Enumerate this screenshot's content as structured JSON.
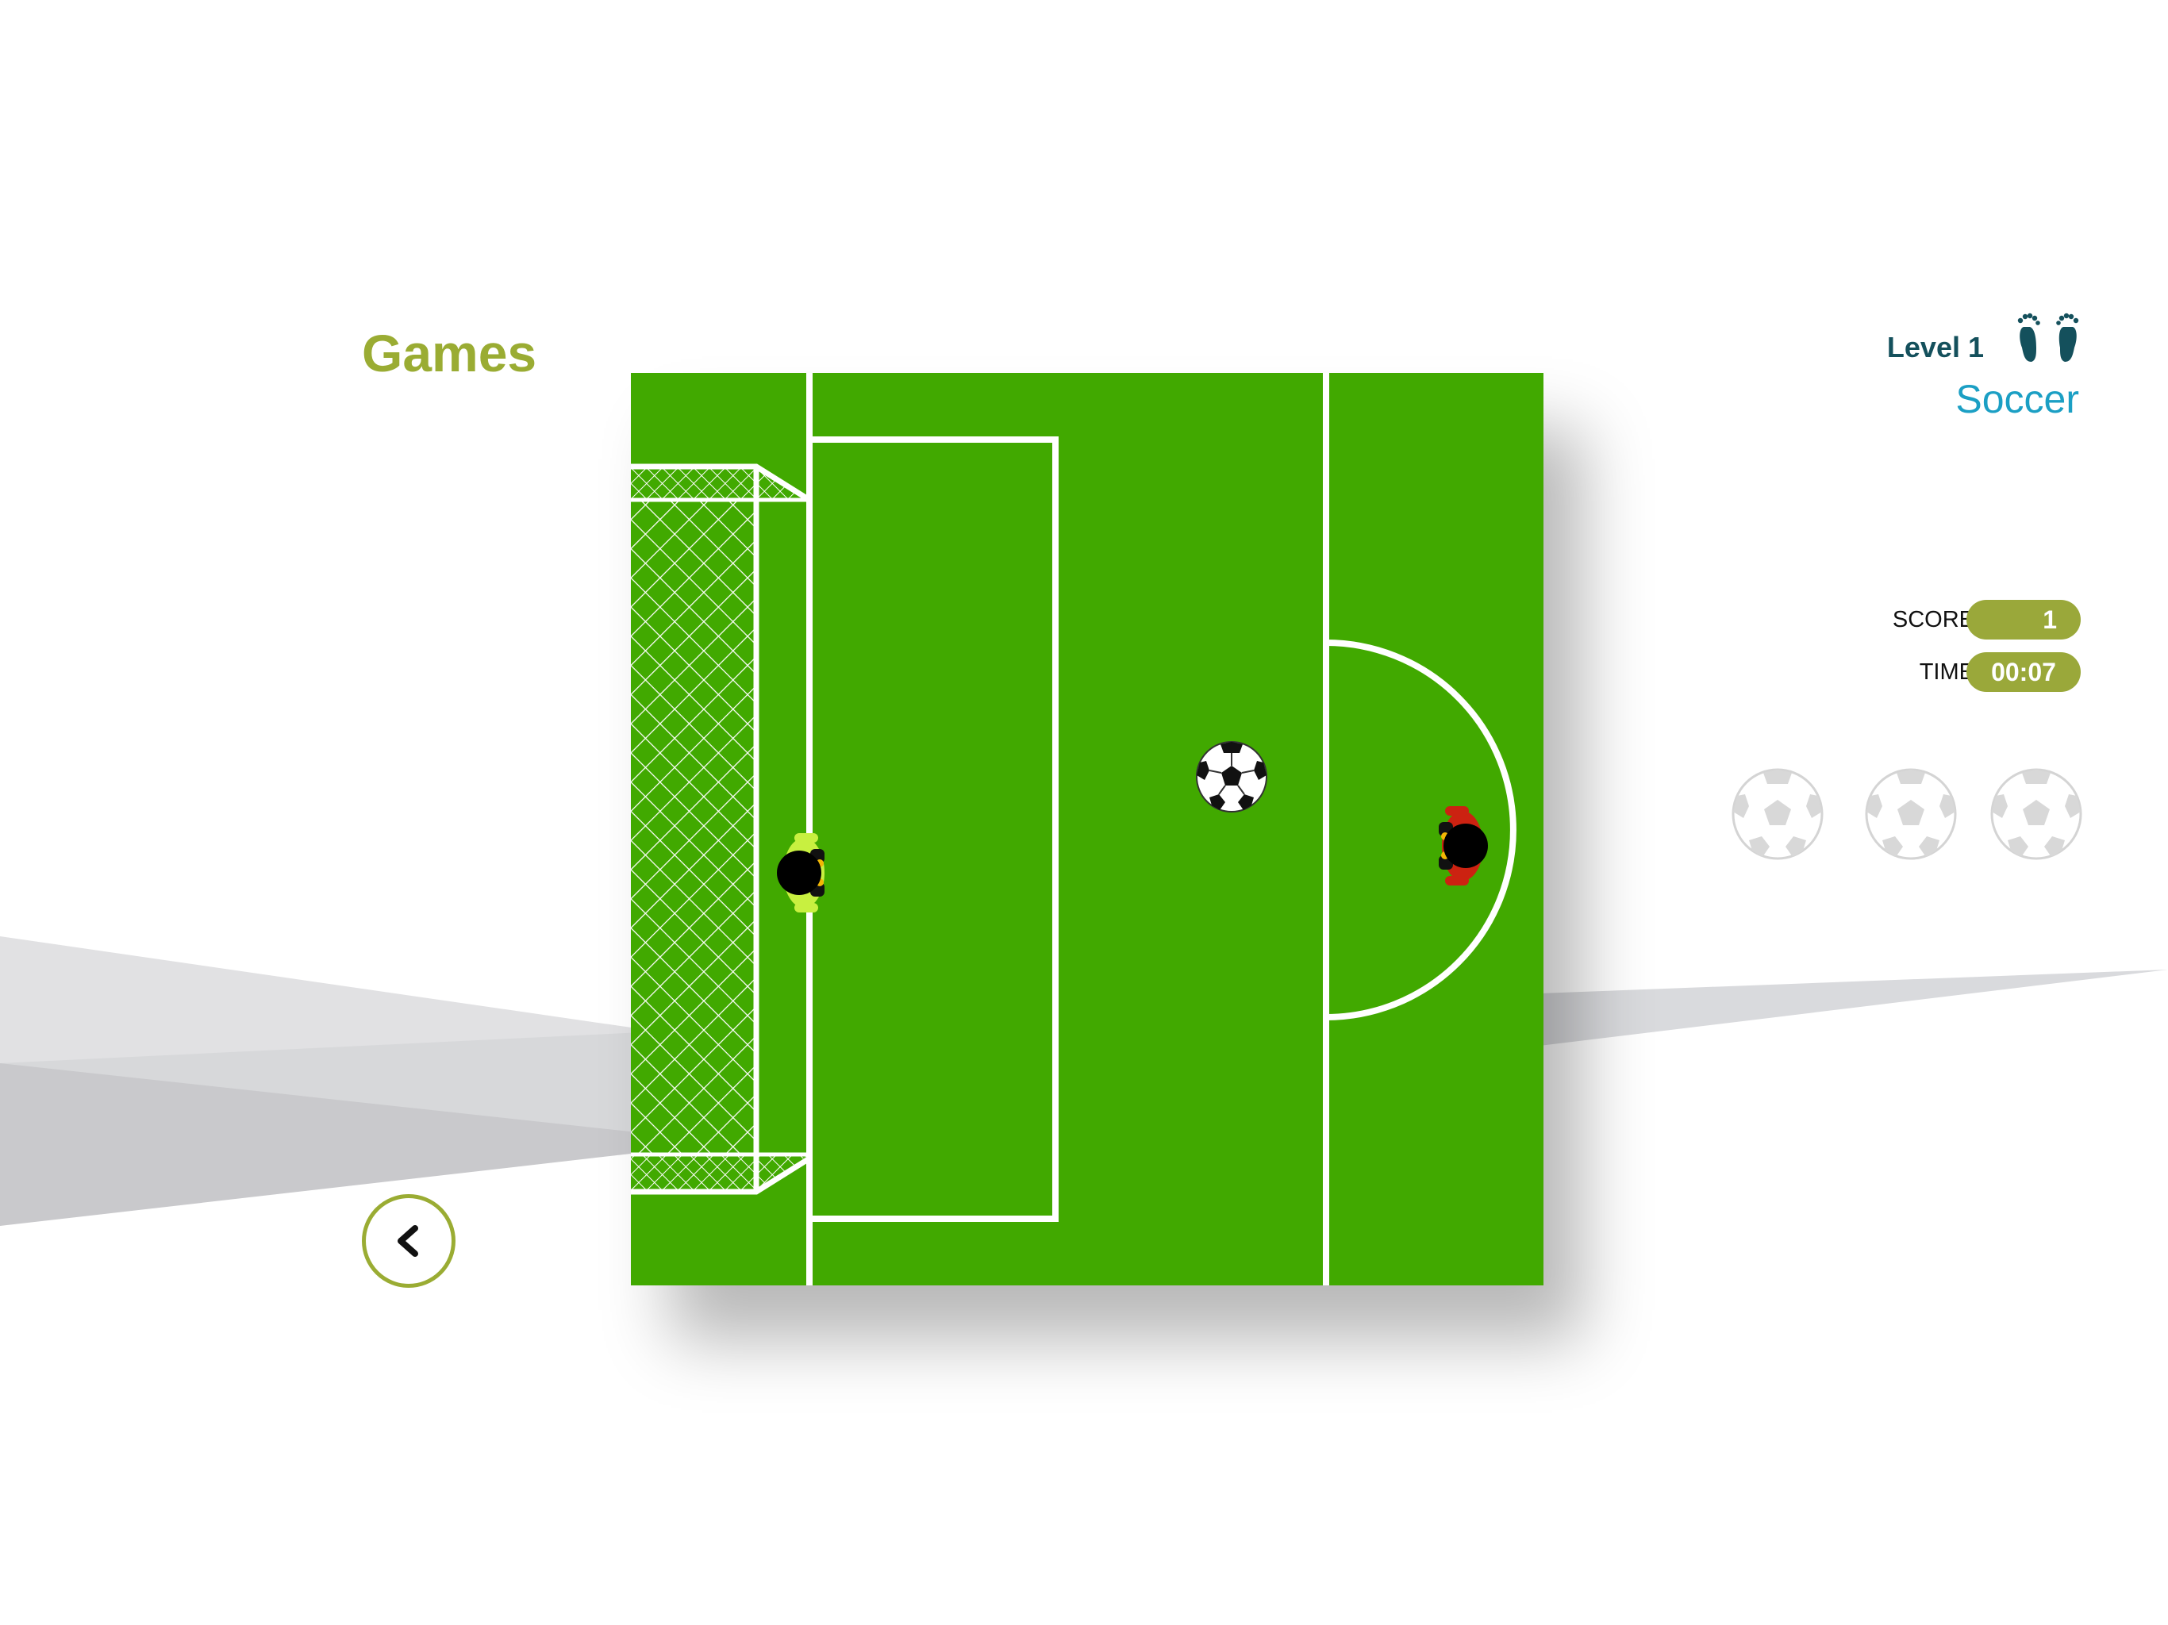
{
  "header": {
    "section_title": "Games",
    "level_label": "Level 1",
    "game_name": "Soccer"
  },
  "stats": {
    "score_label": "SCORE",
    "score_value": "1",
    "time_label": "TIME",
    "time_value": "00:07"
  },
  "lives": {
    "total": 3,
    "icon": "soccer-ball-icon"
  },
  "icons": {
    "back": "chevron-left-icon",
    "level": "footprints-icon"
  },
  "colors": {
    "accent": "#9aac33",
    "level_text": "#14505c",
    "game_name": "#1b9fc4",
    "pitch": "#41a900",
    "goalkeeper_shirt": "#c8f040",
    "striker_shirt": "#cc2211"
  }
}
